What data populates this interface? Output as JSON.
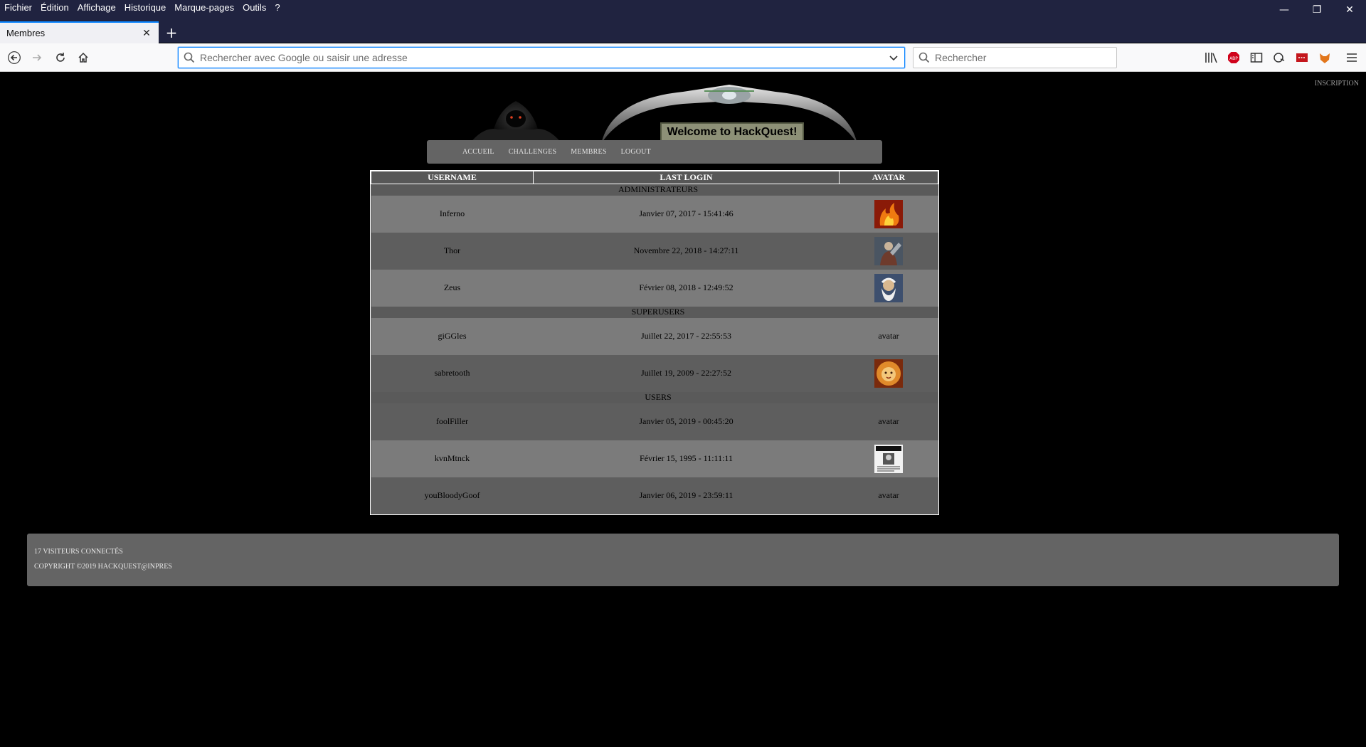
{
  "browser": {
    "menu": [
      "Fichier",
      "Édition",
      "Affichage",
      "Historique",
      "Marque-pages",
      "Outils",
      "?"
    ],
    "tab_title": "Membres",
    "url_placeholder": "Rechercher avec Google ou saisir une adresse",
    "search_placeholder": "Rechercher",
    "toolbar_icons": [
      "library-icon",
      "adblock-icon",
      "sidebar-icon",
      "extension-icon",
      "red-extension-icon",
      "fox-extension-icon",
      "menu-icon"
    ]
  },
  "site": {
    "top_link": "INSCRIPTION",
    "banner_text": "Welcome to HackQuest!",
    "nav": [
      "ACCUEIL",
      "CHALLENGES",
      "MEMBRES",
      "LOGOUT"
    ]
  },
  "members_table": {
    "headers": [
      "USERNAME",
      "LAST LOGIN",
      "AVATAR"
    ],
    "groups": [
      {
        "name": "ADMINISTRATEURS",
        "members": [
          {
            "username": "Inferno",
            "last_login": "Janvier 07, 2017 - 15:41:46",
            "avatar": "fire-avatar-image",
            "avatar_text": ""
          },
          {
            "username": "Thor",
            "last_login": "Novembre 22, 2018 - 14:27:11",
            "avatar": "thor-avatar-image",
            "avatar_text": ""
          },
          {
            "username": "Zeus",
            "last_login": "Février 08, 2018 - 12:49:52",
            "avatar": "zeus-avatar-image",
            "avatar_text": ""
          }
        ]
      },
      {
        "name": "SUPERUSERS",
        "members": [
          {
            "username": "giGGles",
            "last_login": "Juillet 22, 2017 - 22:55:53",
            "avatar": "",
            "avatar_text": "avatar"
          },
          {
            "username": "sabretooth",
            "last_login": "Juillet 19, 2009 - 22:27:52",
            "avatar": "lion-avatar-image",
            "avatar_text": ""
          }
        ]
      },
      {
        "name": "USERS",
        "members": [
          {
            "username": "foolFiller",
            "last_login": "Janvier 05, 2019 - 00:45:20",
            "avatar": "",
            "avatar_text": "avatar"
          },
          {
            "username": "kvnMtnck",
            "last_login": "Février 15, 1995 - 11:11:11",
            "avatar": "wanted-poster-avatar-image",
            "avatar_text": ""
          },
          {
            "username": "youBloodyGoof",
            "last_login": "Janvier 06, 2019 - 23:59:11",
            "avatar": "",
            "avatar_text": "avatar"
          }
        ]
      }
    ]
  },
  "footer": {
    "visitors": "17 VISITEURS CONNECTÉS",
    "copyright": "COPYRIGHT ©2019 HACKQUEST@INPRES"
  },
  "colors": {
    "chrome_dark": "#202340",
    "accent": "#0a84ff",
    "panel_gray": "#646464",
    "row_light": "#7b7b7b",
    "row_dark": "#5e5e5e"
  }
}
